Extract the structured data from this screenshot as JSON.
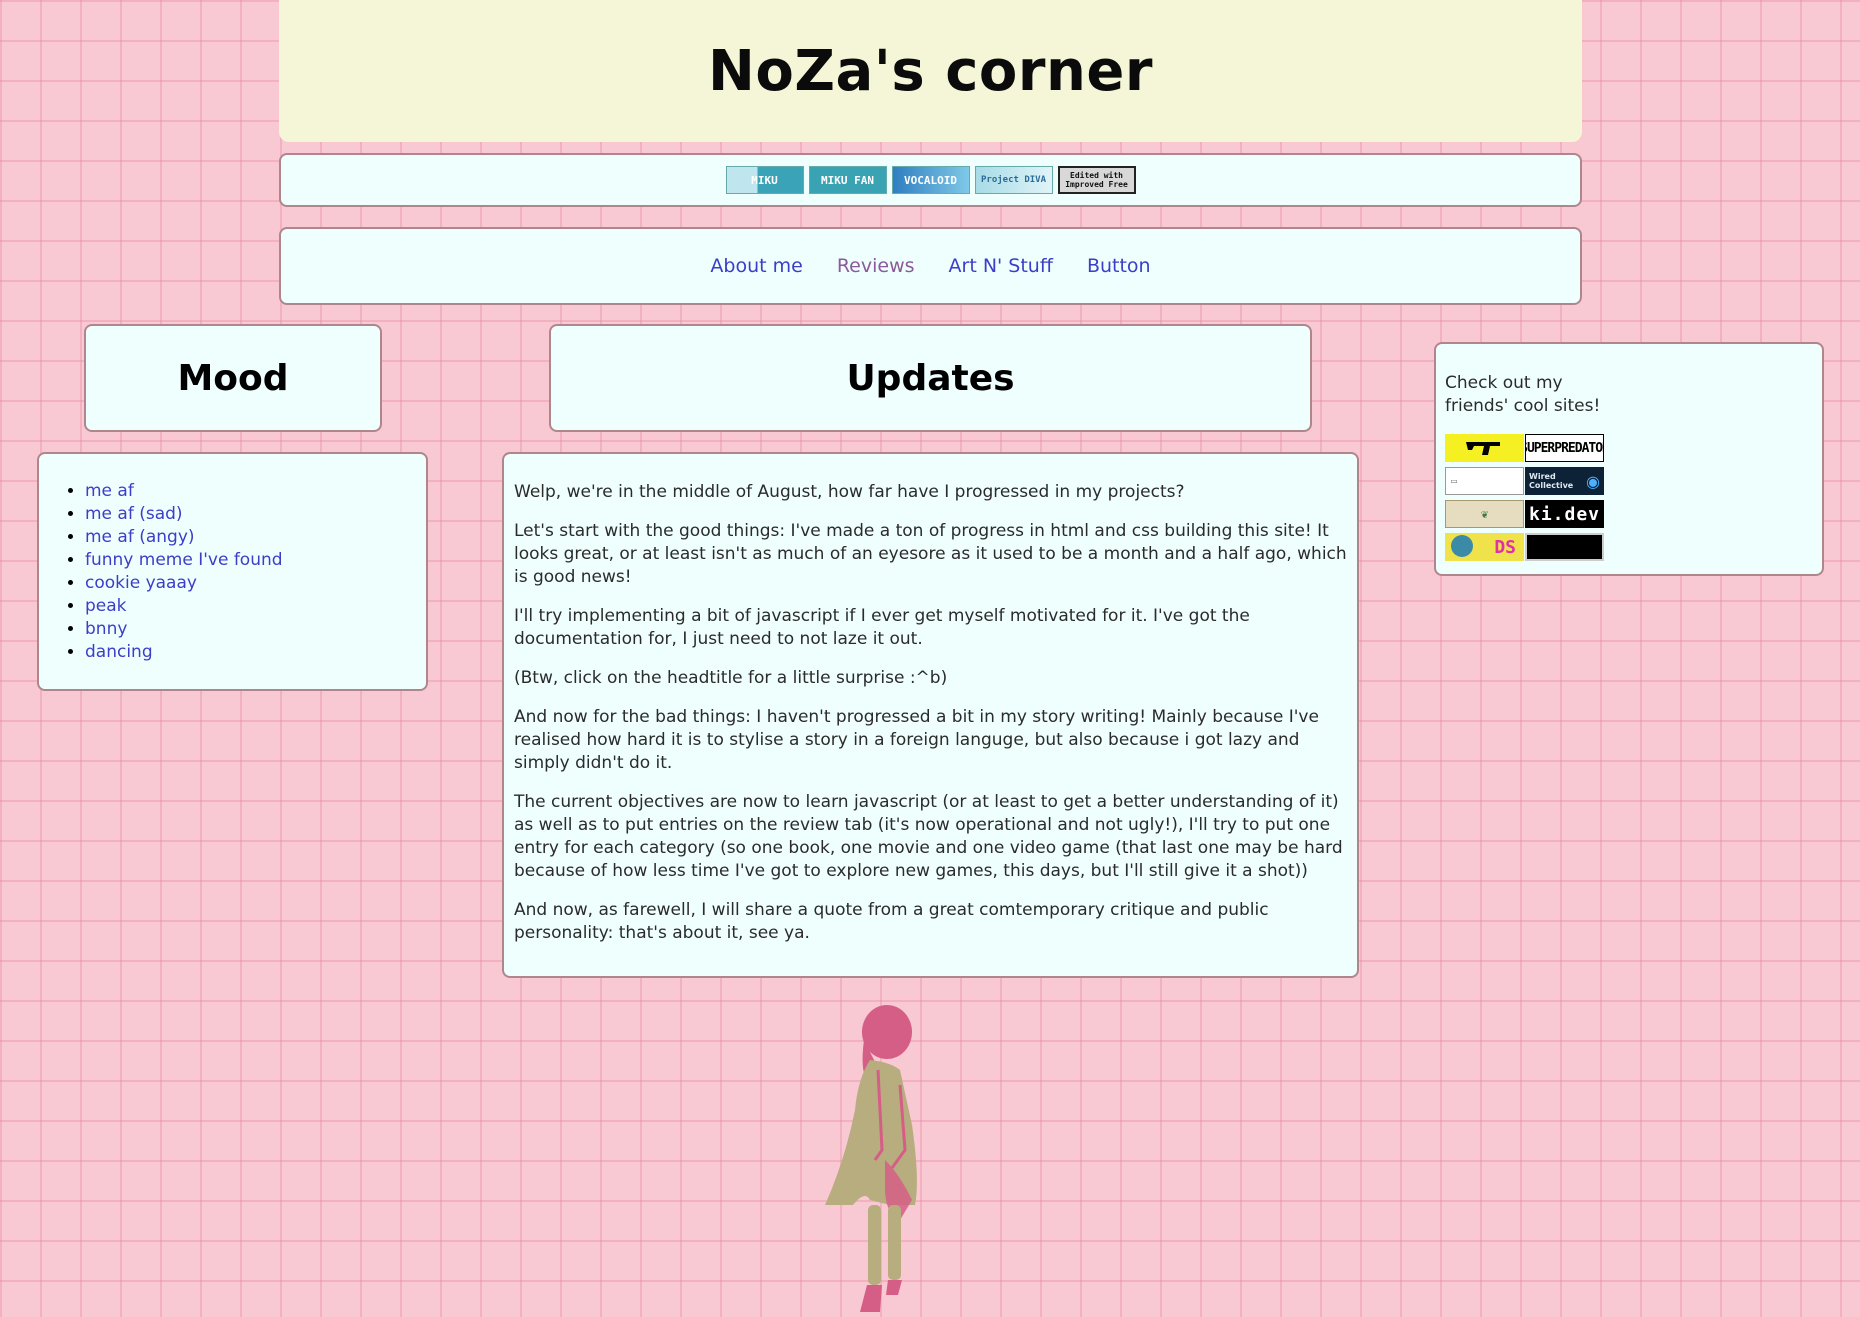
{
  "header": {
    "title": "NoZa's corner"
  },
  "top_badges": [
    {
      "name": "miku-badge-1",
      "label": "MIKU",
      "bg": "#7fd0dc"
    },
    {
      "name": "miku-fan-badge",
      "label": "MIKU FAN",
      "bg": "#39a3b3"
    },
    {
      "name": "vocaloid-badge",
      "label": "VOCALOID",
      "bg": "#4a9fd0"
    },
    {
      "name": "project-diva-badge",
      "label": "Project DIVA",
      "bg": "#9ad4e0"
    },
    {
      "name": "vim-badge",
      "label": "Edited with Improved Free",
      "bg": "#d8d8d8"
    }
  ],
  "nav": {
    "about": "About me",
    "reviews": "Reviews",
    "art": "Art N' Stuff",
    "button": "Button"
  },
  "mood": {
    "title": "Mood",
    "items": [
      "me af",
      "me af (sad)",
      "me af (angy)",
      "funny meme I've found",
      "cookie yaaay",
      "peak",
      "bnny",
      "dancing"
    ]
  },
  "updates": {
    "title": "Updates",
    "paragraphs": [
      "Welp, we're in the middle of August, how far have I progressed in my projects?",
      "Let's start with the good things: I've made a ton of progress in html and css building this site! It looks great, or at least isn't as much of an eyesore as it used to be a month and a half ago, which is good news!",
      "I'll try implementing a bit of javascript if I ever get myself motivated for it. I've got the documentation for, I just need to not laze it out.",
      "(Btw, click on the headtitle for a little surprise :^b)",
      "And now for the bad things: I haven't progressed a bit in my story writing! Mainly because I've realised how hard it is to stylise a story in a foreign languge, but also because i got lazy and simply didn't do it.",
      "The current objectives are now to learn javascript (or at least to get a better understanding of it) as well as to put entries on the review tab (it's now operational and not ugly!), I'll try to put one entry for each category (so one book, one movie and one video game (that last one may be hard because of how less time I've got to explore new games, this days, but I'll still give it a shot))",
      "And now, as farewell, I will share a quote from a great comtemporary critique and public personality: that's about it, see ya."
    ]
  },
  "friends": {
    "intro_line1": "Check out my",
    "intro_line2": "friends' cool sites!",
    "badges": [
      "SUPERPREDATOR",
      "Wired Collective",
      "ki.dev",
      "DS"
    ]
  },
  "colors": {
    "background": "#f8c9d3",
    "panel": "#effffe",
    "header": "#f5f5d8",
    "link": "#3d3dc8",
    "visited_link": "#8a5a9a"
  }
}
